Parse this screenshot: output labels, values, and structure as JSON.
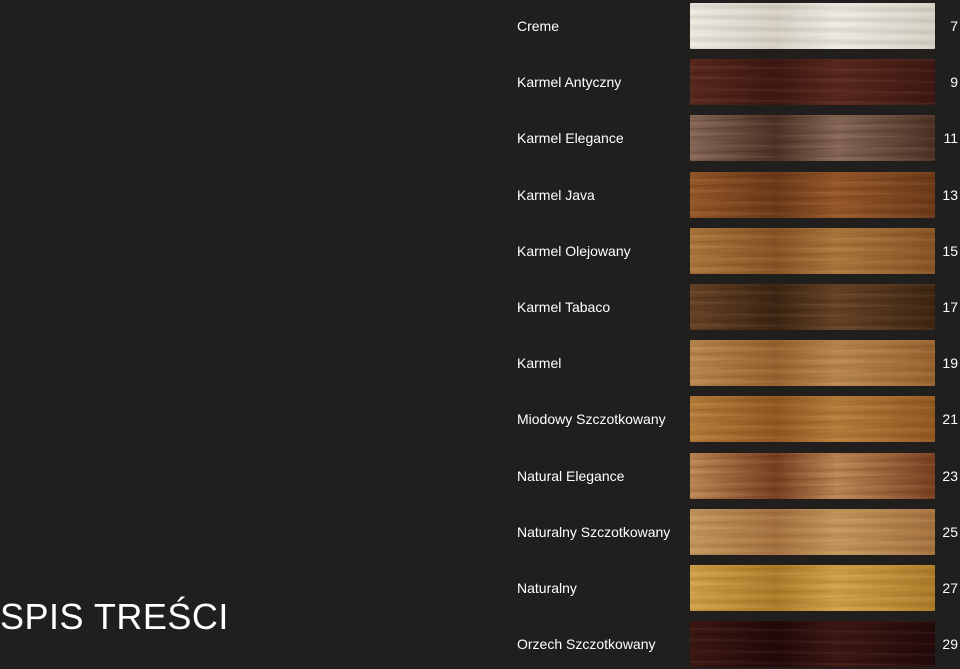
{
  "title": "SPIS TREŚCI",
  "entries": [
    {
      "label": "Creme",
      "page": "7",
      "color_a": "#efebe3",
      "color_b": "#d8d2c6",
      "grain": "#c8c0b2"
    },
    {
      "label": "Karmel Antyczny",
      "page": "9",
      "color_a": "#5c2a1e",
      "color_b": "#3f1812",
      "grain": "#2a0d08"
    },
    {
      "label": "Karmel Elegance",
      "page": "11",
      "color_a": "#8a6a58",
      "color_b": "#4e3226",
      "grain": "#2e1a12"
    },
    {
      "label": "Karmel Java",
      "page": "13",
      "color_a": "#9a5a2a",
      "color_b": "#6e3a18",
      "grain": "#4a240c"
    },
    {
      "label": "Karmel Olejowany",
      "page": "15",
      "color_a": "#b07a3e",
      "color_b": "#8a5526",
      "grain": "#6a3c16"
    },
    {
      "label": "Karmel Tabaco",
      "page": "17",
      "color_a": "#6a4426",
      "color_b": "#3e2612",
      "grain": "#22140a"
    },
    {
      "label": "Karmel",
      "page": "19",
      "color_a": "#bd8a50",
      "color_b": "#9a6430",
      "grain": "#7a4a20"
    },
    {
      "label": "Miodowy Szczotkowany",
      "page": "21",
      "color_a": "#b8803c",
      "color_b": "#955a22",
      "grain": "#7a4414"
    },
    {
      "label": "Natural Elegance",
      "page": "23",
      "color_a": "#c08a56",
      "color_b": "#7a4020",
      "grain": "#5a2810"
    },
    {
      "label": "Naturalny Szczotkowany",
      "page": "25",
      "color_a": "#c89a60",
      "color_b": "#a87440",
      "grain": "#8a5a2c"
    },
    {
      "label": "Naturalny",
      "page": "27",
      "color_a": "#d4a44c",
      "color_b": "#b07e2a",
      "grain": "#8e5e18"
    },
    {
      "label": "Orzech Szczotkowany",
      "page": "29",
      "color_a": "#3e1812",
      "color_b": "#24090a",
      "grain": "#150405"
    }
  ]
}
